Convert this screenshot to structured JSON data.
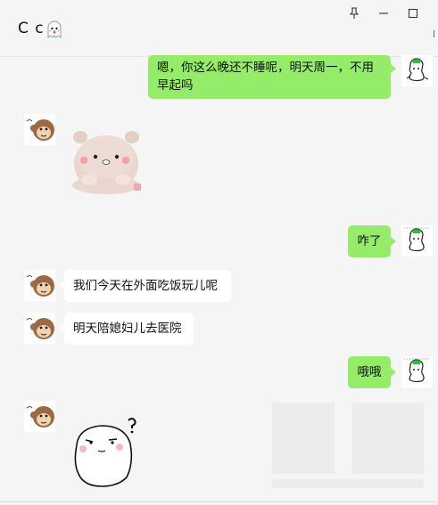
{
  "header": {
    "title": "C c",
    "pin_icon": "pin-icon",
    "minimize_icon": "minimize-icon",
    "maximize_icon": "maximize-icon"
  },
  "messages": [
    {
      "from": "me",
      "type": "text",
      "text_line1": "嗯，你这么晚还不睡呢，明天周一，不用",
      "text_line2": "早起吗"
    },
    {
      "from": "them",
      "type": "sticker",
      "sticker": "pink-bear-sticker"
    },
    {
      "from": "me",
      "type": "text",
      "text": "咋了"
    },
    {
      "from": "them",
      "type": "text",
      "text": "我们今天在外面吃饭玩儿呢"
    },
    {
      "from": "them",
      "type": "text",
      "text": "明天陪媳妇儿去医院"
    },
    {
      "from": "me",
      "type": "text",
      "text": "哦哦"
    },
    {
      "from": "them",
      "type": "sticker",
      "sticker": "confused-face-sticker"
    }
  ],
  "avatars": {
    "me": "ghost-sketch-avatar",
    "them": "monkey-avatar"
  },
  "colors": {
    "outgoing_bubble": "#95ec69",
    "incoming_bubble": "#ffffff",
    "background": "#f5f5f5"
  }
}
